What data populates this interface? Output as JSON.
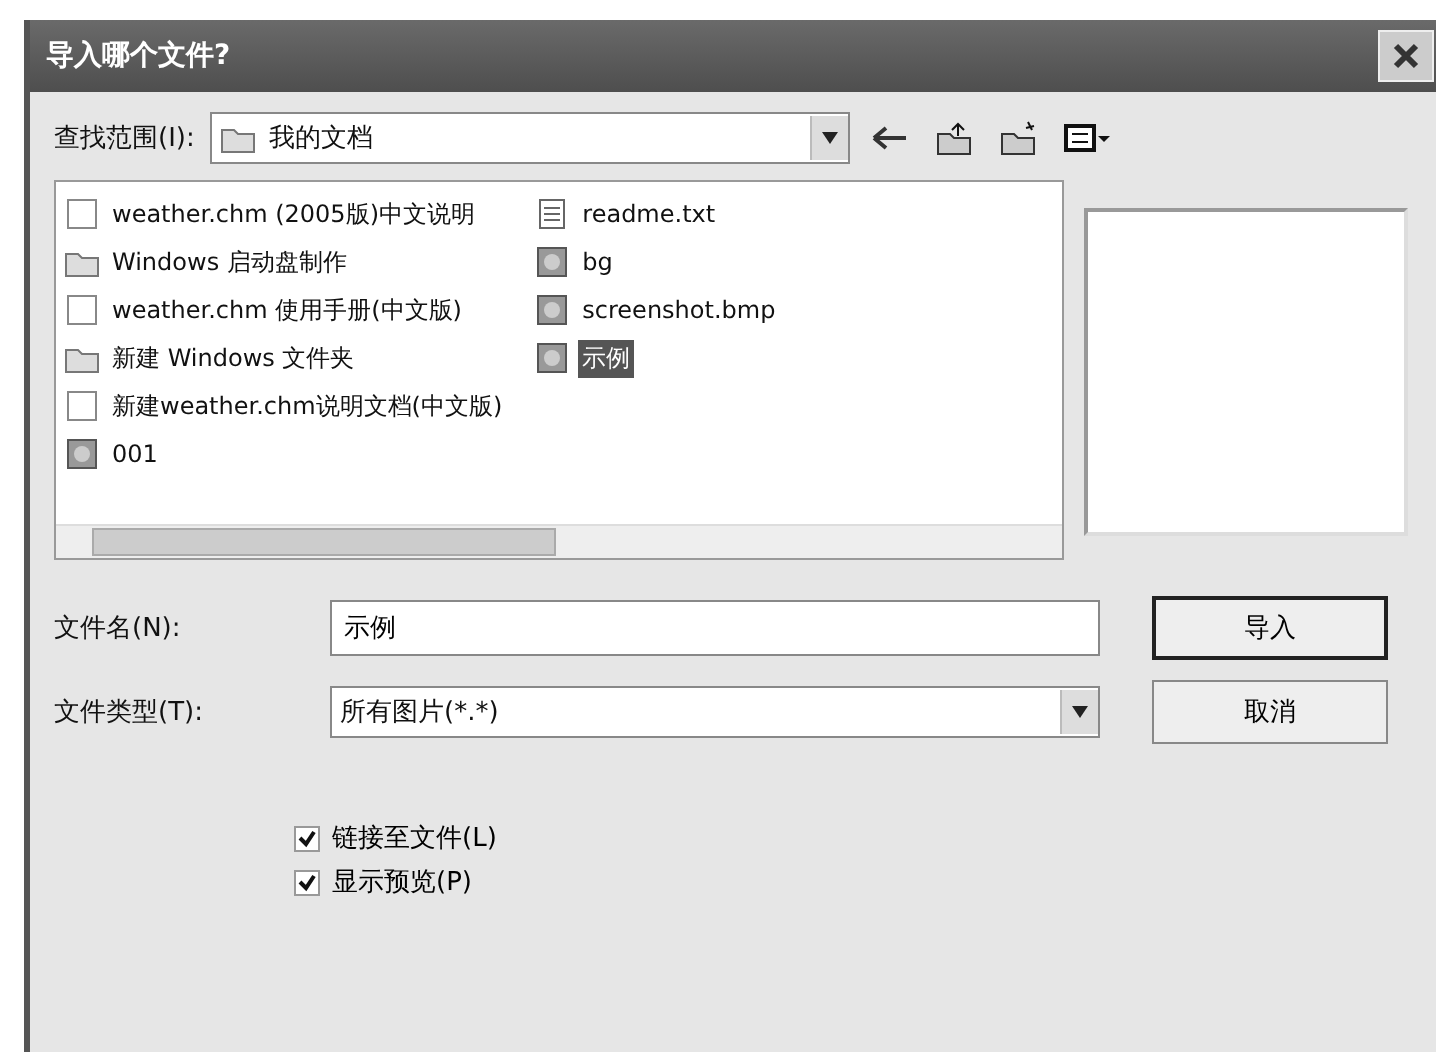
{
  "window": {
    "title": "导入哪个文件?"
  },
  "look_in": {
    "label": "查找范围(I):",
    "value": "我的文档"
  },
  "files": [
    {
      "name": "weather.chm (2005版)中文说明",
      "kind": "document",
      "selected": false
    },
    {
      "name": "Windows 启动盘制作",
      "kind": "folder",
      "selected": false
    },
    {
      "name": "weather.chm 使用手册(中文版)",
      "kind": "document",
      "selected": false
    },
    {
      "name": "新建 Windows 文件夹",
      "kind": "folder",
      "selected": false
    },
    {
      "name": "新建weather.chm说明文档(中文版)",
      "kind": "document",
      "selected": false
    },
    {
      "name": "001",
      "kind": "image",
      "selected": false
    },
    {
      "name": "readme.txt",
      "kind": "text",
      "selected": false
    },
    {
      "name": "bg",
      "kind": "image",
      "selected": false
    },
    {
      "name": "screenshot.bmp",
      "kind": "image",
      "selected": false
    },
    {
      "name": "示例",
      "kind": "image",
      "selected": true
    }
  ],
  "file_name": {
    "label": "文件名(N):",
    "value": "示例"
  },
  "file_type": {
    "label": "文件类型(T):",
    "value": "所有图片(*.*)"
  },
  "buttons": [
    "导入",
    "取消"
  ],
  "options": [
    {
      "label": "链接至文件(L)",
      "checked": true
    },
    {
      "label": "显示预览(P)",
      "checked": true
    }
  ]
}
